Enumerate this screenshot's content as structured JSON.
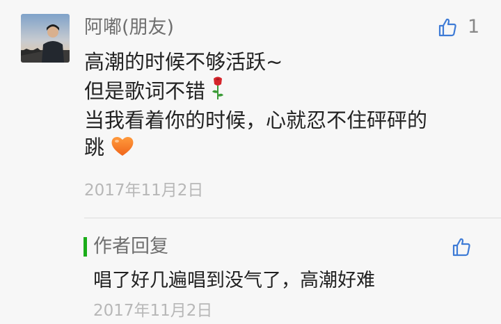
{
  "comment": {
    "nickname": "阿嘟(朋友)",
    "like_count": "1",
    "lines": [
      "高潮的时候不够活跃~",
      "但是歌词不错",
      "当我看着你的时候，心就忍不住砰砰的",
      "跳"
    ],
    "emojis": [
      "rose-icon",
      "orange-heart-icon"
    ],
    "date": "2017年11月2日"
  },
  "reply": {
    "title": "作者回复",
    "content": "唱了好几遍唱到没气了，高潮好难",
    "date": "2017年11月2日"
  },
  "colors": {
    "background": "#f7f7f7",
    "accent": "#1aad19",
    "like_icon": "#3e7bd6",
    "secondary_text": "#6f6f6f",
    "date_text": "#b7b7b7"
  }
}
